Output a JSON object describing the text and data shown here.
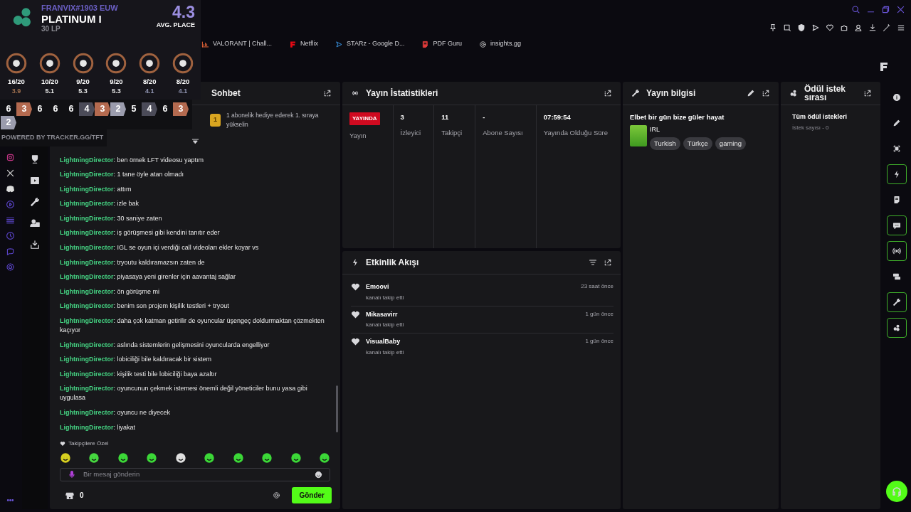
{
  "bookmarks": [
    {
      "label": "VALORANT | Chall...",
      "kind": "chart"
    },
    {
      "label": "Netflix",
      "kind": "netflix"
    },
    {
      "label": "STARz - Google D...",
      "kind": "drive"
    },
    {
      "label": "PDF Guru",
      "kind": "pdf"
    },
    {
      "label": "insights.gg",
      "kind": "gear"
    }
  ],
  "tracker_overlay": {
    "riot_id": "FRANVIX#1903 EUW",
    "rank": "PLATINUM I",
    "lp": "30 LP",
    "avg_place": "4.3",
    "avg_place_label": "AVG. PLACE",
    "traits": [
      {
        "record": "16/20",
        "avg": "3.9",
        "color": "#a0704f"
      },
      {
        "record": "10/20",
        "avg": "5.1",
        "color": "#e6e6e6"
      },
      {
        "record": "9/20",
        "avg": "5.3",
        "color": "#e6e6e6"
      },
      {
        "record": "9/20",
        "avg": "5.3",
        "color": "#e6e6e6"
      },
      {
        "record": "8/20",
        "avg": "4.1",
        "color": "#8f93b0"
      },
      {
        "record": "8/20",
        "avg": "4.1",
        "color": "#8f93b0"
      }
    ],
    "placements": [
      {
        "value": "6"
      },
      {
        "value": "3",
        "color": "#b46a4f"
      },
      {
        "value": "6"
      },
      {
        "value": "6"
      },
      {
        "value": "6"
      },
      {
        "value": "4",
        "color": "#4b4b58"
      },
      {
        "value": "3",
        "color": "#b46a4f"
      },
      {
        "value": "2",
        "color": "#9b9cad"
      },
      {
        "value": "5"
      },
      {
        "value": "4",
        "color": "#4b4b58"
      },
      {
        "value": "6"
      },
      {
        "value": "3",
        "color": "#b46a4f"
      },
      {
        "value": "2",
        "color": "#9b9cad"
      }
    ],
    "footer": "POWERED BY TRACKER.GG/TFT"
  },
  "chat": {
    "title": "Sohbet",
    "gift_rank": "1",
    "gift_prompt": "1 abonelik hediye ederek 1. sıraya yükselin",
    "messages": [
      {
        "user": "LightningDirector",
        "text": ": ben örnek LFT videosu yaptım"
      },
      {
        "user": "LightningDirector",
        "text": ": 1 tane öyle atan olmadı"
      },
      {
        "user": "LightningDirector",
        "text": ": attım"
      },
      {
        "user": "LightningDirector",
        "text": ": izle bak"
      },
      {
        "user": "LightningDirector",
        "text": ": 30 saniye zaten"
      },
      {
        "user": "LightningDirector",
        "text": ": iş görüşmesi gibi kendini tanıtır eder"
      },
      {
        "user": "LightningDirector",
        "text": ": IGL se oyun içi verdiği call videoları ekler koyar vs"
      },
      {
        "user": "LightningDirector",
        "text": ": tryoutu kaldıramazsın zaten de"
      },
      {
        "user": "LightningDirector",
        "text": ": piyasaya yeni girenler için aavantaj sağlar"
      },
      {
        "user": "LightningDirector",
        "text": ": ön görüşme mi"
      },
      {
        "user": "LightningDirector",
        "text": ": benim son projem kişilik testleri + tryout"
      },
      {
        "user": "LightningDirector",
        "text": ": daha çok katman getirilir de oyuncular üşengeç doldurmaktan çözmekten kaçıyor"
      },
      {
        "user": "LightningDirector",
        "text": ": aslında sistemlerin gelişmesini oyuncularda engelliyor"
      },
      {
        "user": "LightningDirector",
        "text": ": lobiciliği bile kaldıracak bir sistem"
      },
      {
        "user": "LightningDirector",
        "text": ": kişilik testi bile lobiciliği baya azaltır"
      },
      {
        "user": "LightningDirector",
        "text": ": oyuncunun çekmek istemesi önemli değil yöneticiler bunu yasa gibi uygulasa"
      },
      {
        "user": "LightningDirector",
        "text": ": oyuncu ne diyecek"
      },
      {
        "user": "LightningDirector",
        "text": ": liyakat"
      }
    ],
    "emote_section": "Takipçilere Özel",
    "input": {
      "placeholder": "Bir mesaj gönderin"
    },
    "points": "0",
    "send_label": "Gönder"
  },
  "stats": {
    "title": "Yayın İstatistikleri",
    "status": "YAYINDA",
    "status_label": "Yayın",
    "items": [
      {
        "value": "3",
        "label": "İzleyici"
      },
      {
        "value": "11",
        "label": "Takipçi"
      },
      {
        "value": "-",
        "label": "Abone Sayısı"
      },
      {
        "value": "07:59:54",
        "label": "Yayında Olduğu Süre"
      }
    ]
  },
  "activity": {
    "title": "Etkinlik Akışı",
    "events": [
      {
        "name": "Emoovi",
        "action": "kanalı takip etti",
        "time": "23 saat önce"
      },
      {
        "name": "Mikasavirr",
        "action": "kanalı takip etti",
        "time": "1 gün önce"
      },
      {
        "name": "VisualBaby",
        "action": "kanalı takip etti",
        "time": "1 gün önce"
      }
    ]
  },
  "stream_info": {
    "title": "Yayın bilgisi",
    "stream_title": "Elbet bir gün bize güler hayat",
    "category": "IRL",
    "tags": [
      "Turkish",
      "Türkçe",
      "gaming"
    ]
  },
  "rewards": {
    "title": "Ödül istek sırası",
    "subtitle": "Tüm ödül istekleri",
    "count": "İstek sayısı - 0"
  },
  "rail": [
    {
      "kind": "info",
      "active": false
    },
    {
      "kind": "pencil",
      "active": false
    },
    {
      "kind": "focus",
      "active": false
    },
    {
      "kind": "bolt",
      "active": true
    },
    {
      "kind": "note",
      "active": false
    },
    {
      "kind": "chat",
      "active": true
    },
    {
      "kind": "broadcast",
      "active": true
    },
    {
      "kind": "camera",
      "active": false
    },
    {
      "kind": "wrench",
      "active": true
    },
    {
      "kind": "dots",
      "active": true
    }
  ]
}
